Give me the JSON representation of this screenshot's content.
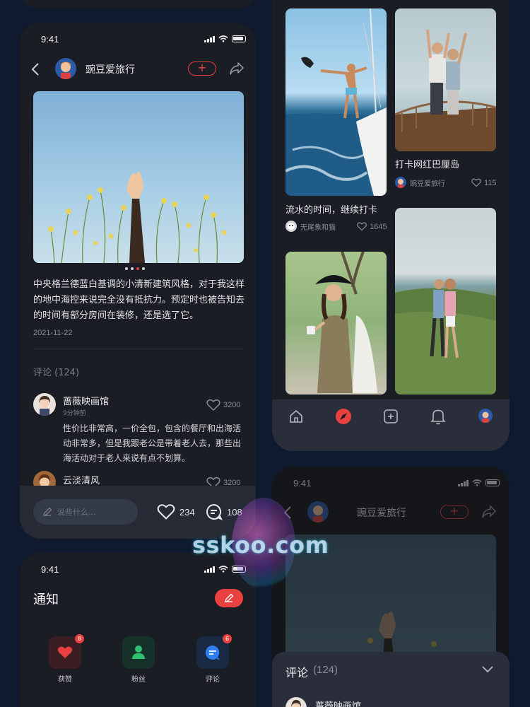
{
  "detail": {
    "status_time": "9:41",
    "author_name": "豌豆爱旅行",
    "follow_symbol": "+",
    "carousel_dots": 4,
    "post_text": "中央格兰德蓝白基调的小清新建筑风格，对于我这样的地中海控来说完全没有抵抗力。预定时也被告知去的时间有部分房间在装修，还是选了它。",
    "post_date": "2021-11-22",
    "comments_header": "评论 (124)",
    "comments": [
      {
        "name": "蔷薇映画馆",
        "time": "9分钟前",
        "likes": "3200",
        "text": "性价比非常高，一价全包，包含的餐厅和出海活动非常多，但是我跟老公是带着老人去，那些出海活动对于老人来说有点不划算。"
      },
      {
        "name": "云淡清风",
        "time": "",
        "likes": "3200",
        "text": ""
      }
    ],
    "input_placeholder": "说些什么...",
    "like_count": "234",
    "comment_count": "108"
  },
  "feed": {
    "cards": [
      {
        "title": "流水的时间，继续打卡",
        "author": "无尾象和猫",
        "likes": "1645"
      },
      {
        "title": "打卡网红巴厘岛",
        "author": "豌豆爱旅行",
        "likes": "115"
      }
    ],
    "tabs": [
      "home-icon",
      "discover-icon",
      "add-icon",
      "bell-icon",
      "profile-icon"
    ],
    "accent_color": "#e8413f"
  },
  "notify": {
    "status_time": "9:41",
    "title": "通知",
    "categories": [
      {
        "label": "获赞",
        "badge": "8",
        "icon": "heart-icon",
        "color": "#e8413f"
      },
      {
        "label": "粉丝",
        "badge": "",
        "icon": "user-icon",
        "color": "#2fbf71"
      },
      {
        "label": "评论",
        "badge": "6",
        "icon": "chat-icon",
        "color": "#2f7df0"
      }
    ]
  },
  "sheet": {
    "status_time": "9:41",
    "author_name": "豌豆爱旅行",
    "follow_symbol": "+",
    "comments_header": "评论",
    "comments_count": "(124)",
    "first_comment_name": "蔷薇映画馆"
  },
  "watermark": "sskoo.com"
}
